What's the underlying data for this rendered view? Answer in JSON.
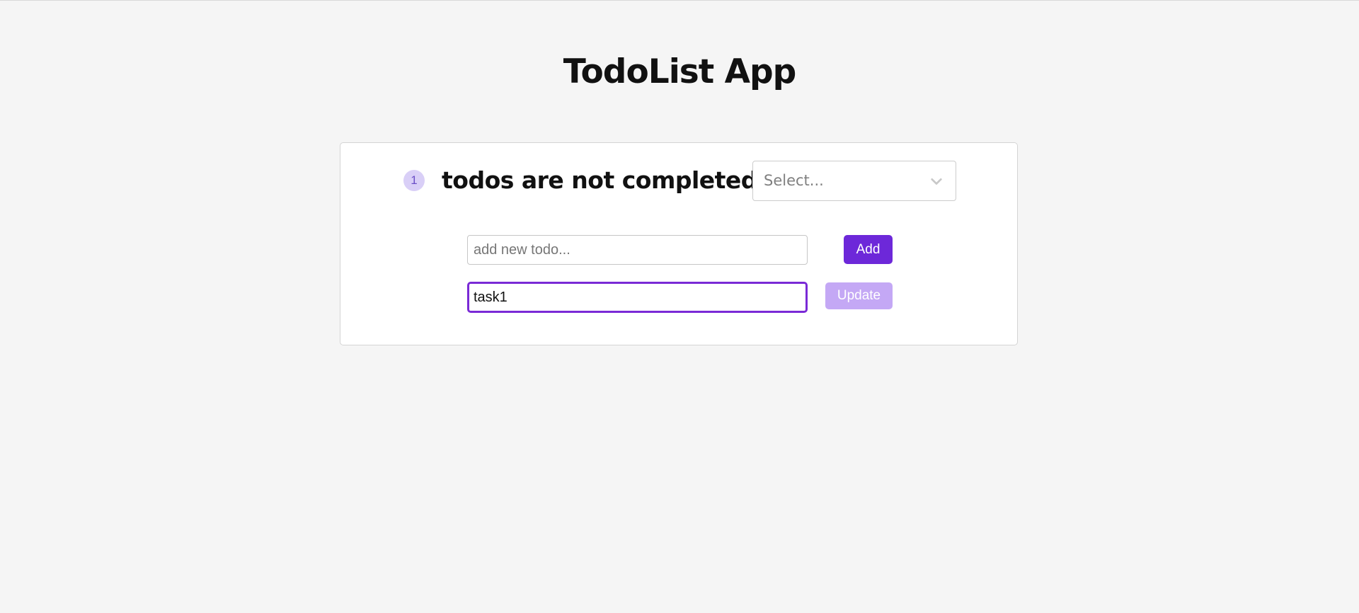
{
  "header": {
    "title": "TodoList App"
  },
  "status": {
    "count": "1",
    "text": "todos are not completed"
  },
  "filter": {
    "placeholder": "Select...",
    "icon": "chevron-down-icon"
  },
  "add_form": {
    "placeholder": "add new todo...",
    "value": "",
    "button_label": "Add"
  },
  "edit_form": {
    "value": "task1",
    "button_label": "Update"
  },
  "colors": {
    "accent": "#6d28d9",
    "accent_disabled": "#c4a8f5",
    "focus_border": "#7a2ad6",
    "badge_bg": "#d9cff7",
    "page_bg": "#f5f5f5"
  }
}
